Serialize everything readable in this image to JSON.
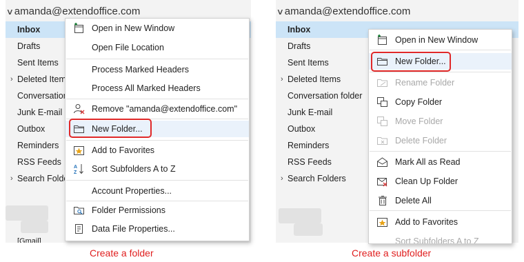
{
  "left": {
    "account": "amanda@extendoffice.com",
    "nav": [
      {
        "label": "Inbox",
        "selected": true,
        "expander": ""
      },
      {
        "label": "Drafts",
        "selected": false,
        "expander": ""
      },
      {
        "label": "Sent Items",
        "selected": false,
        "expander": ""
      },
      {
        "label": "Deleted Items",
        "selected": false,
        "expander": "›"
      },
      {
        "label": "Conversation",
        "selected": false,
        "expander": ""
      },
      {
        "label": "Junk E-mail",
        "selected": false,
        "expander": ""
      },
      {
        "label": "Outbox",
        "selected": false,
        "expander": ""
      },
      {
        "label": "Reminders",
        "selected": false,
        "expander": ""
      },
      {
        "label": "RSS Feeds",
        "selected": false,
        "expander": ""
      },
      {
        "label": "Search Folde",
        "selected": false,
        "expander": "›"
      }
    ],
    "bottom_label": "[Gmail]",
    "menu": [
      {
        "label": "Open in New Window",
        "icon": "new-window-icon",
        "disabled": false
      },
      {
        "label": "Open File Location",
        "icon": "",
        "disabled": false
      },
      {
        "label": "Process Marked Headers",
        "icon": "",
        "disabled": false
      },
      {
        "label": "Process All Marked Headers",
        "icon": "",
        "disabled": false
      },
      {
        "label": "Remove \"amanda@extendoffice.com\"",
        "icon": "remove-account-icon",
        "disabled": false
      },
      {
        "label": "New Folder...",
        "icon": "folder-icon",
        "disabled": false
      },
      {
        "label": "Add to Favorites",
        "icon": "favorites-star-icon",
        "disabled": false
      },
      {
        "label": "Sort Subfolders A to Z",
        "icon": "sort-az-icon",
        "disabled": false
      },
      {
        "label": "Account Properties...",
        "icon": "",
        "disabled": false
      },
      {
        "label": "Folder Permissions",
        "icon": "folder-permissions-icon",
        "disabled": false
      },
      {
        "label": "Data File Properties...",
        "icon": "data-file-icon",
        "disabled": false
      }
    ],
    "caption": "Create a folder"
  },
  "right": {
    "account": "amanda@extendoffice.com",
    "nav": [
      {
        "label": "Inbox",
        "selected": true,
        "expander": ""
      },
      {
        "label": "Drafts",
        "selected": false,
        "expander": ""
      },
      {
        "label": "Sent Items",
        "selected": false,
        "expander": ""
      },
      {
        "label": "Deleted Items",
        "selected": false,
        "expander": "›"
      },
      {
        "label": "Conversation folder",
        "selected": false,
        "expander": ""
      },
      {
        "label": "Junk E-mail",
        "selected": false,
        "expander": ""
      },
      {
        "label": "Outbox",
        "selected": false,
        "expander": ""
      },
      {
        "label": "Reminders",
        "selected": false,
        "expander": ""
      },
      {
        "label": "RSS Feeds",
        "selected": false,
        "expander": ""
      },
      {
        "label": "Search Folders",
        "selected": false,
        "expander": "›"
      }
    ],
    "menu": [
      {
        "label": "Open in New Window",
        "icon": "new-window-icon",
        "disabled": false
      },
      {
        "label": "New Folder...",
        "icon": "folder-icon",
        "disabled": false
      },
      {
        "label": "Rename Folder",
        "icon": "rename-folder-icon",
        "disabled": true
      },
      {
        "label": "Copy Folder",
        "icon": "copy-folder-icon",
        "disabled": false
      },
      {
        "label": "Move Folder",
        "icon": "move-folder-icon",
        "disabled": true
      },
      {
        "label": "Delete Folder",
        "icon": "delete-folder-icon",
        "disabled": true
      },
      {
        "label": "Mark All as Read",
        "icon": "mark-read-icon",
        "disabled": false
      },
      {
        "label": "Clean Up Folder",
        "icon": "clean-up-icon",
        "disabled": false
      },
      {
        "label": "Delete All",
        "icon": "delete-all-icon",
        "disabled": false
      },
      {
        "label": "Add to Favorites",
        "icon": "favorites-star-icon",
        "disabled": false
      },
      {
        "label": "Sort Subfolders A to Z",
        "icon": "sort-az-icon",
        "disabled": false
      }
    ],
    "caption": "Create a subfolder"
  },
  "colors": {
    "highlight": "#e02828",
    "selection": "#cce4f7",
    "caption": "#e01e1e"
  }
}
